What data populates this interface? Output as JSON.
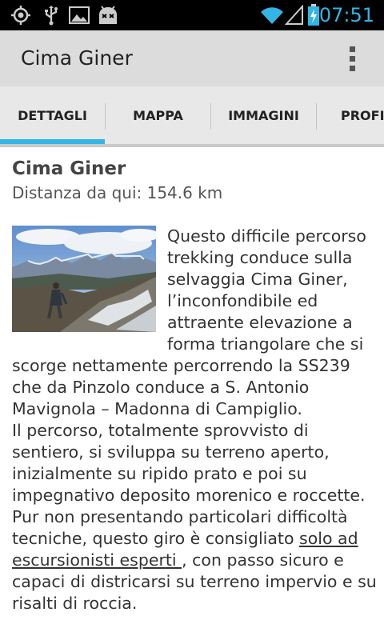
{
  "status_bar": {
    "time": "07:51",
    "icons": [
      "gps-icon",
      "usb-icon",
      "gallery-icon",
      "android-debug-icon",
      "wifi-icon",
      "signal-icon",
      "battery-charging-icon"
    ]
  },
  "action_bar": {
    "title": "Cima Giner",
    "menu_icon": "overflow-menu-icon"
  },
  "tabs": [
    {
      "label": "DETTAGLI",
      "selected": true
    },
    {
      "label": "MAPPA",
      "selected": false
    },
    {
      "label": "IMMAGINI",
      "selected": false
    },
    {
      "label": "PROFIL",
      "selected": false
    }
  ],
  "colors": {
    "accent": "#33b5e5",
    "actionbar": "#dcdcdc",
    "tabs": "#e8e8e8"
  },
  "detail": {
    "title": "Cima Giner",
    "distance": "Distanza da qui: 154.6 km",
    "paragraph1": "Questo difficile percorso trekking conduce sulla selvaggia Cima Giner, l’inconfondibile ed attraente elevazione a forma triangolare che si scorge nettamente percorrendo la SS239 che da Pinzolo conduce a S. Antonio Mavignola – Madonna di Campiglio.",
    "paragraph2_before": "Il percorso, totalmente sprovvisto di sentiero, si sviluppa su terreno aperto, inizialmente su ripido prato e poi su impegnativo deposito morenico e roccette. Pur non presentando particolari difficoltà tecniche, questo giro è consigliato ",
    "paragraph2_underlined": "solo ad escursionisti esperti ",
    "paragraph2_after": ", con passo sicuro e capaci di districarsi su terreno impervio e su risalti di roccia."
  }
}
